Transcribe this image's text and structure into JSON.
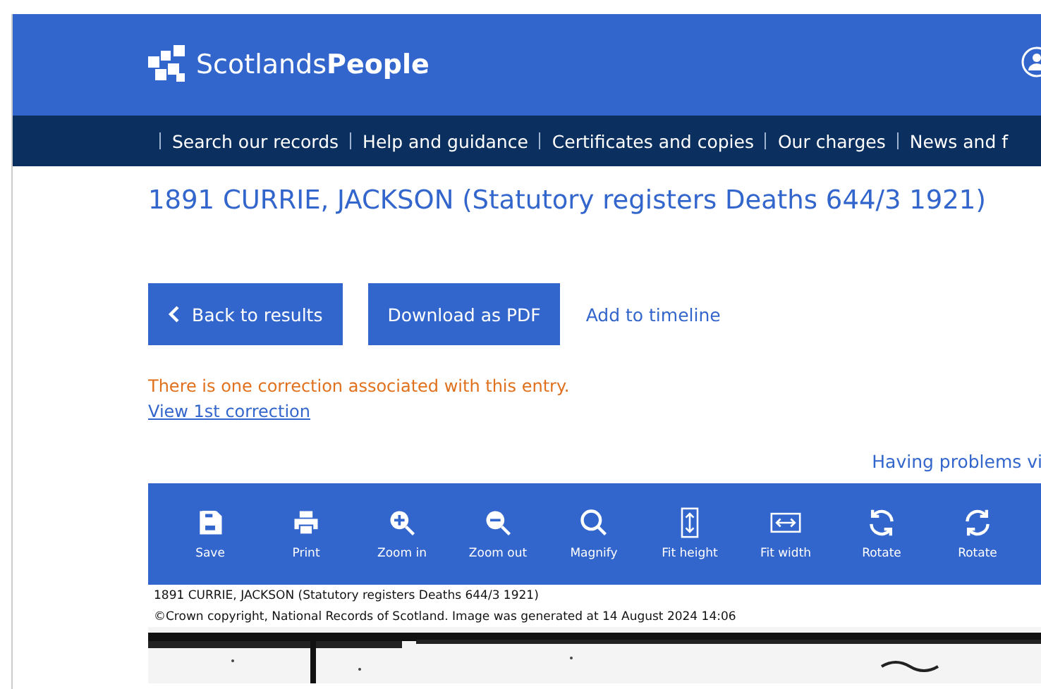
{
  "header": {
    "logo_text_light": "Scotlands",
    "logo_text_bold": "People"
  },
  "nav": [
    "Search our records",
    "Help and guidance",
    "Certificates and copies",
    "Our charges",
    "News and f"
  ],
  "title": "1891 CURRIE, JACKSON (Statutory registers Deaths 644/3 1921)",
  "actions": [
    {
      "kind": "back",
      "label": "Back to results"
    },
    {
      "kind": "primary",
      "label": "Download as PDF"
    },
    {
      "kind": "link",
      "label": "Add to timeline"
    }
  ],
  "correction": {
    "message": "There is one correction associated with this entry.",
    "link": "View 1st correction"
  },
  "help_link": "Having problems vi",
  "viewer": {
    "tools": [
      {
        "label": "Save"
      },
      {
        "label": "Print"
      },
      {
        "label": "Zoom in"
      },
      {
        "label": "Zoom out"
      },
      {
        "label": "Magnify"
      },
      {
        "label": "Fit height"
      },
      {
        "label": "Fit width"
      },
      {
        "label": "Rotate"
      },
      {
        "label": "Rotate"
      }
    ],
    "caption": [
      "1891 CURRIE, JACKSON (Statutory registers Deaths 644/3 1921)",
      "©Crown copyright, National Records of Scotland. Image was generated at 14 August 2024 14:06"
    ],
    "image": {
      "kind": "picture"
    }
  }
}
